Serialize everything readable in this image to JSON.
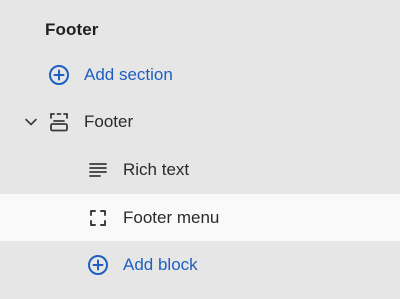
{
  "sidebar": {
    "section_title": "Footer",
    "add_section_label": "Add section",
    "section": {
      "label": "Footer",
      "expanded": true,
      "blocks": [
        {
          "label": "Rich text",
          "icon": "text-lines-icon"
        },
        {
          "label": "Footer menu",
          "icon": "dashed-square-icon",
          "selected": true
        }
      ],
      "add_block_label": "Add block"
    }
  },
  "colors": {
    "panel_background": "#e6e6e6",
    "selected_row_background": "#f9f9f9",
    "link_blue": "#1e5fc2",
    "text": "#2a2a2a",
    "icon": "#3a3a3a"
  }
}
